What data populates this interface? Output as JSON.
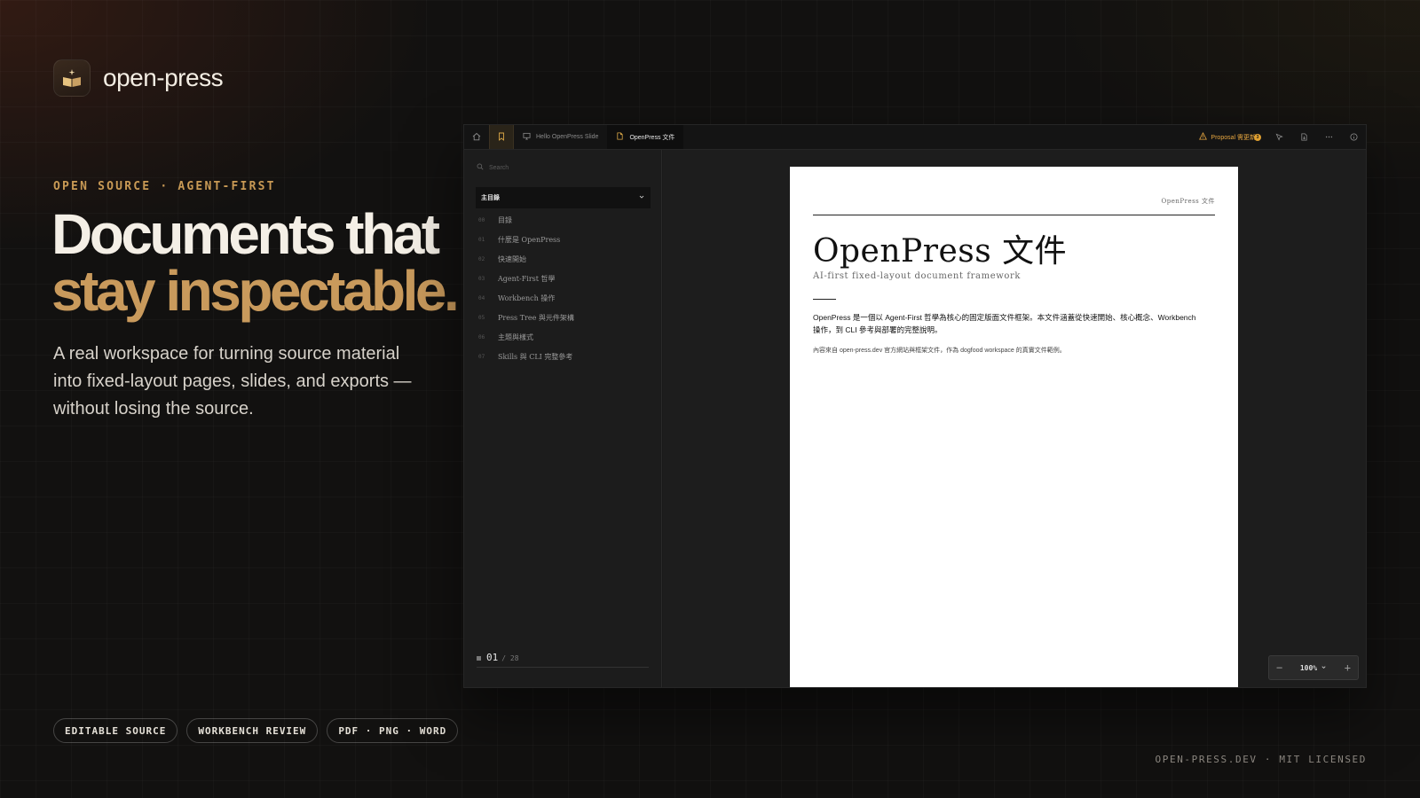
{
  "brand": {
    "name": "open-press"
  },
  "hero": {
    "eyebrow": "OPEN SOURCE · AGENT-FIRST",
    "headline_line1": "Documents that",
    "headline_line2": "stay inspectable.",
    "lede": "A real workspace for turning source material into fixed-layout pages, slides, and exports —without losing the source."
  },
  "pills": [
    "EDITABLE SOURCE",
    "WORKBENCH REVIEW",
    "PDF · PNG · WORD"
  ],
  "footer": {
    "note": "OPEN-PRESS.DEV · MIT LICENSED"
  },
  "app": {
    "tabs": [
      {
        "label": "Hello OpenPress Slide",
        "icon": "monitor-icon"
      },
      {
        "label": "OpenPress 文件",
        "icon": "document-icon"
      }
    ],
    "proposal": {
      "label": "Proposal 需更新",
      "badge": "3"
    },
    "sidebar": {
      "search_placeholder": "Search",
      "toc_select": "主目錄",
      "toc": [
        {
          "num": "00",
          "label": "目錄"
        },
        {
          "num": "01",
          "label": "什麼是 OpenPress"
        },
        {
          "num": "02",
          "label": "快速開始"
        },
        {
          "num": "03",
          "label": "Agent-First 哲學"
        },
        {
          "num": "04",
          "label": "Workbench 操作"
        },
        {
          "num": "05",
          "label": "Press Tree 與元件架構"
        },
        {
          "num": "06",
          "label": "主題與樣式"
        },
        {
          "num": "07",
          "label": "Skills 與 CLI 完整參考"
        }
      ],
      "pager_current": "01",
      "pager_total": "/ 28"
    },
    "page": {
      "header": "OpenPress 文件",
      "title": "OpenPress 文件",
      "subtitle": "AI-first fixed-layout document framework",
      "body": "OpenPress 是一個以 Agent-First 哲學為核心的固定版面文件框架。本文件涵蓋從快速開始、核心概念、Workbench 操作，到 CLI 參考與部署的完整說明。",
      "note": "內容來自 open-press.dev 官方網站與框架文件，作為 dogfood workspace 的真實文件範例。"
    },
    "zoom": {
      "value": "100%"
    }
  }
}
